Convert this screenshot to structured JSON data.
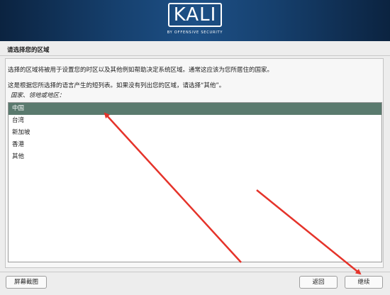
{
  "header": {
    "logo_text": "KALI",
    "tagline": "BY OFFENSIVE SECURITY"
  },
  "page_title": "请选择您的区域",
  "description_line1": "选择的区域将被用于设置您的时区以及其他例如帮助决定系统区域。通常这应该为您所居住的国家。",
  "description_line2": "这是根据您所选择的语言产生的短列表。如果没有列出您的区域，请选择“其他”。",
  "question_label": "国家、领地或地区：",
  "regions": [
    "中国",
    "台湾",
    "新加坡",
    "香港",
    "其他"
  ],
  "selected_region": "中国",
  "buttons": {
    "screenshot": "屏幕截图",
    "back": "返回",
    "continue": "继续"
  },
  "colors": {
    "selection": "#5a7a6e",
    "annotation_arrow": "#e5332a"
  }
}
